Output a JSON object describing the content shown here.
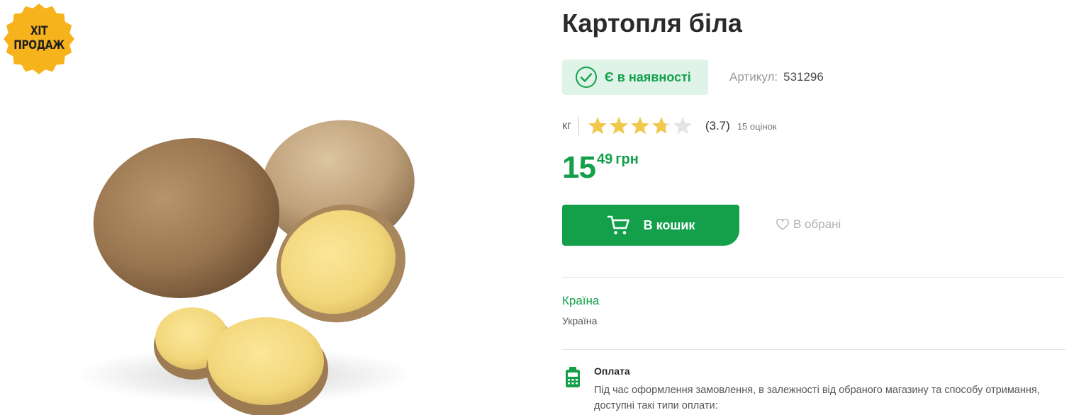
{
  "badge": {
    "line1": "ХІТ",
    "line2": "ПРОДАЖ"
  },
  "product": {
    "title": "Картопля біла",
    "image_icon": "potato-photo"
  },
  "stock": {
    "label": "Є в наявності",
    "icon": "check-circle-icon"
  },
  "sku": {
    "label": "Артикул:",
    "value": "531296"
  },
  "rating": {
    "unit": "кг",
    "value": 3.7,
    "max": 5,
    "value_text": "(3.7)",
    "count_text": "15 оцінок"
  },
  "price": {
    "main": "15",
    "cents": "49",
    "currency": "грн"
  },
  "actions": {
    "cart_label": "В кошик",
    "favorite_label": "В обрані"
  },
  "attributes": {
    "country_label": "Країна",
    "country_value": "Україна"
  },
  "payment": {
    "title": "Оплата",
    "description": "Під час оформлення замовлення, в залежності від обраного магазину та способу отримання, доступні такі типи оплати:"
  },
  "colors": {
    "accent": "#14a04b",
    "stock_bg": "#dff3e8",
    "star": "#f1c84b",
    "star_empty": "#e4e4e4",
    "badge": "#f7b31c"
  }
}
